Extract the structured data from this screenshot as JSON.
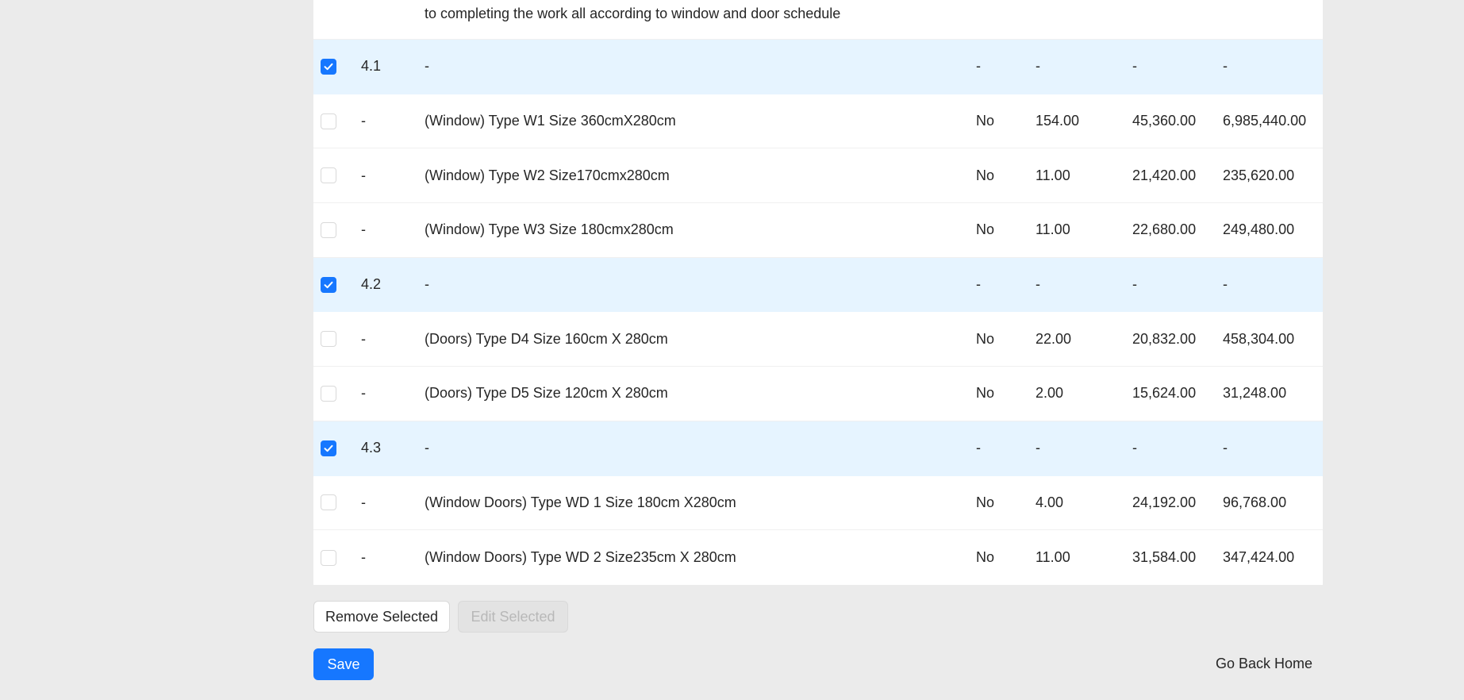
{
  "description_continuation": "to completing the work all according to window and door schedule",
  "rows": [
    {
      "selected": true,
      "no": "4.1",
      "desc": "-",
      "flag": "-",
      "qty": "-",
      "rate": "-",
      "amount": "-"
    },
    {
      "selected": false,
      "no": "-",
      "desc": "(Window) Type W1 Size 360cmX280cm",
      "flag": "No",
      "qty": "154.00",
      "rate": "45,360.00",
      "amount": "6,985,440.00"
    },
    {
      "selected": false,
      "no": "-",
      "desc": "(Window) Type W2 Size170cmx280cm",
      "flag": "No",
      "qty": "11.00",
      "rate": "21,420.00",
      "amount": "235,620.00"
    },
    {
      "selected": false,
      "no": "-",
      "desc": "(Window) Type W3 Size 180cmx280cm",
      "flag": "No",
      "qty": "11.00",
      "rate": "22,680.00",
      "amount": "249,480.00"
    },
    {
      "selected": true,
      "no": "4.2",
      "desc": "-",
      "flag": "-",
      "qty": "-",
      "rate": "-",
      "amount": "-"
    },
    {
      "selected": false,
      "no": "-",
      "desc": "(Doors) Type D4 Size 160cm X 280cm",
      "flag": "No",
      "qty": "22.00",
      "rate": "20,832.00",
      "amount": "458,304.00"
    },
    {
      "selected": false,
      "no": "-",
      "desc": "(Doors) Type D5 Size 120cm X 280cm",
      "flag": "No",
      "qty": "2.00",
      "rate": "15,624.00",
      "amount": "31,248.00"
    },
    {
      "selected": true,
      "no": "4.3",
      "desc": "-",
      "flag": "-",
      "qty": "-",
      "rate": "-",
      "amount": "-"
    },
    {
      "selected": false,
      "no": "-",
      "desc": "(Window Doors) Type WD 1 Size 180cm X280cm",
      "flag": "No",
      "qty": "4.00",
      "rate": "24,192.00",
      "amount": "96,768.00"
    },
    {
      "selected": false,
      "no": "-",
      "desc": "(Window Doors) Type WD 2 Size235cm X 280cm",
      "flag": "No",
      "qty": "11.00",
      "rate": "31,584.00",
      "amount": "347,424.00"
    }
  ],
  "actions": {
    "remove_label": "Remove Selected",
    "edit_label": "Edit Selected",
    "save_label": "Save",
    "home_label": "Go Back Home"
  },
  "colors": {
    "accent": "#1677ff",
    "group_row_bg": "#e6f4ff",
    "page_bg": "#ebebeb"
  },
  "icons": {
    "checkbox_checked": "check-icon"
  }
}
